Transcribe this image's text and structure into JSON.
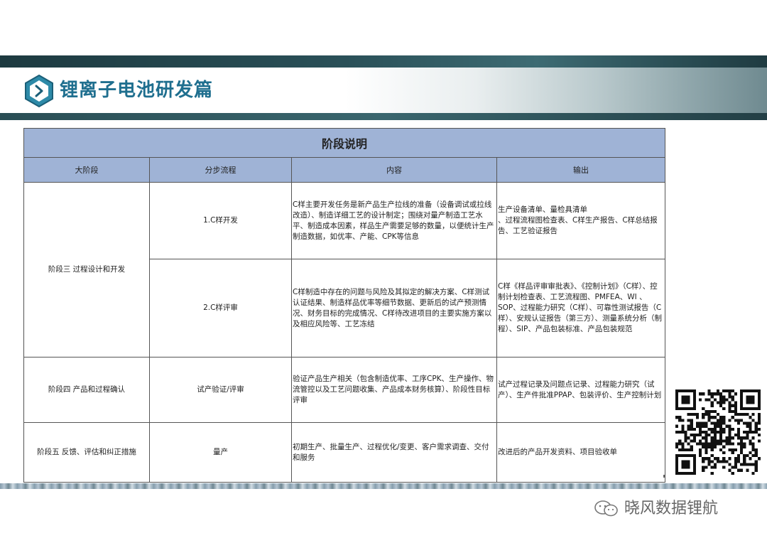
{
  "header": {
    "title": "锂离子电池研发篇",
    "colors": {
      "accent": "#1f6f8f",
      "table_header": "#9fb3d6"
    }
  },
  "table": {
    "title": "阶段说明",
    "columns": [
      "大阶段",
      "分步流程",
      "内容",
      "输出"
    ],
    "rows": [
      {
        "stage": "阶段三 过程设计和开发",
        "steps": [
          {
            "name": "1.C样开发",
            "content": "C样主要开发任务是新产品生产拉线的准备（设备调试或拉线改造）、制造详细工艺的设计制定；围绕对量产制造工艺水平、制造成本因素，样品生产需要足够的数量，以便统计生产制造数据，如优率、产能、CPK等信息",
            "output": "生产设备清单、量检具清单\n、过程流程图检查表、C样生产报告、C样总结报告、工艺验证报告"
          },
          {
            "name": "2.C样评审",
            "content": "C样制造中存在的问题与风险及其拟定的解决方案、C样测试认证结果、制造样品优率等细节数据、更新后的试产预测情况、财务目标的完成情况、C样待改进项目的主要实施方案以及相应风险等、工艺冻结",
            "output": "C样《样品评审审批表》、《控制计划》（C样）、控制计划检查表、工艺流程图、PMFEA、WI 、SOP、过程能力研究（C样）、可靠性测试报告（C样）、安规认证报告（第三方）、测量系统分析（制程）、SIP、产品包装标准、产品包装规范"
          }
        ]
      },
      {
        "stage": "阶段四 产品和过程确认",
        "steps": [
          {
            "name": "试产验证/评审",
            "content": "验证产品生产相关（包含制造优率、工序CPK、生产操作、物流管控以及工艺问题收集、产品成本财务核算）、阶段性目标评审",
            "output": "试产过程记录及问题点记录、过程能力研究（试产）、生产件批准PPAP、包装评价、生产控制计划"
          }
        ]
      },
      {
        "stage": "阶段五 反馈、评估和纠正措施",
        "steps": [
          {
            "name": "量产",
            "content": "初期生产、批量生产、过程优化/变更、客户需求调查、交付和服务",
            "output": "改进后的产品开发资料、项目验收单"
          }
        ]
      }
    ]
  },
  "watermark": {
    "text": "晓风数据锂航",
    "icon": "wechat-icon"
  },
  "qr": {
    "icon": "qr-code-icon"
  },
  "logo": {
    "icon": "hexagon-chevron-right-icon"
  }
}
